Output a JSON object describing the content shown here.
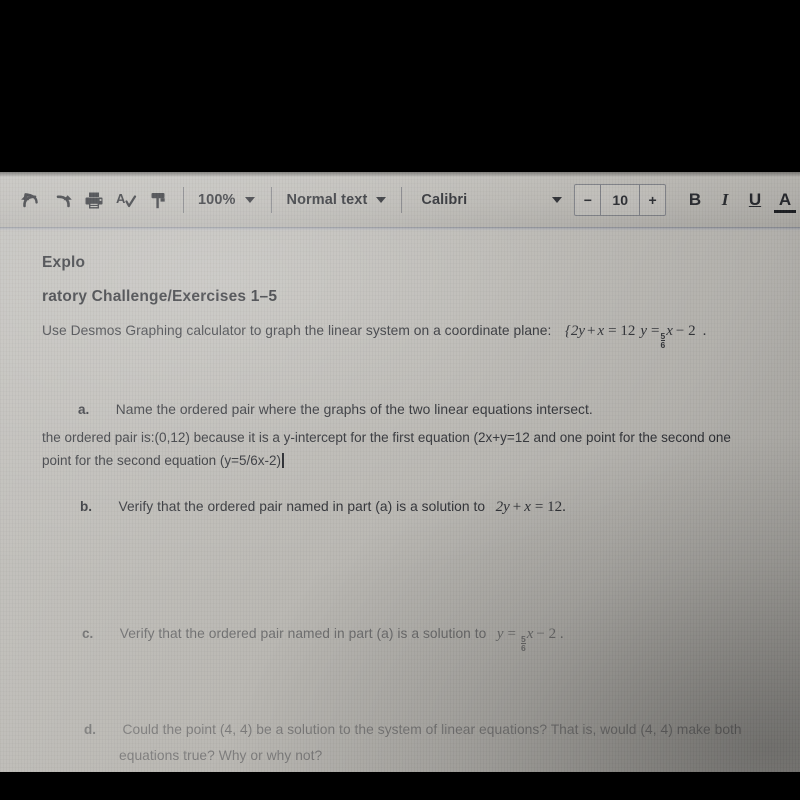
{
  "app": {
    "type": "document-editor",
    "screen_bg": "#b9b7b2",
    "text_color": "#2a2c31"
  },
  "toolbar": {
    "undo_icon": "undo-arrow-icon",
    "redo_icon": "redo-arrow-icon",
    "print_icon": "printer-icon",
    "spellcheck_icon": "spellcheck-icon",
    "paint_format_icon": "paint-format-icon",
    "zoom_value": "100%",
    "style_value": "Normal text",
    "font_value": "Calibri",
    "font_size_decrease": "−",
    "font_size_value": "10",
    "font_size_increase": "+",
    "bold_label": "B",
    "italic_label": "I",
    "underline_label": "U",
    "text_color_label": "A"
  },
  "document": {
    "heading_line1": "Explo",
    "heading_line2": "ratory Challenge/Exercises 1–5",
    "intro": {
      "text": "Use Desmos Graphing calculator to graph the linear system on a coordinate plane:",
      "equation_open": "{2y",
      "equation_plus": "+",
      "equation_x": "x",
      "equation_eq1": "= 12",
      "equation_y": "y",
      "equation_eq2": "=",
      "frac_num": "5",
      "frac_den": "6",
      "equation_x2": "x",
      "equation_minus": "− 2",
      "equation_period": "."
    },
    "items": [
      {
        "letter": "a.",
        "text": "Name the ordered pair where the graphs of the two linear equations intersect."
      },
      {
        "letter": "b.",
        "text": "Verify that the ordered pair named in part (a) is a solution to",
        "eq_y": "2y",
        "eq_plus": "+",
        "eq_x": "x",
        "eq_tail": "= 12."
      },
      {
        "letter": "c.",
        "text": "Verify that the ordered pair named in part (a) is a solution to",
        "eq_y": "y",
        "eq_eq": "=",
        "frac_num": "5",
        "frac_den": "6",
        "eq_x": "x",
        "eq_tail": "− 2 ."
      },
      {
        "letter": "d.",
        "text_line1": "Could the point (4, 4) be a solution to the system of linear equations?  That is, would (4, 4) make both",
        "text_line2": "equations true?  Why or why not?"
      }
    ],
    "answer": {
      "line1": "the ordered  pair is:(0,12) because it is a y-intercept for the first equation (2x+y=12  and one point for the second one",
      "line2": "point for the second equation (y=5/6x-2)",
      "caret": "text-cursor"
    }
  }
}
